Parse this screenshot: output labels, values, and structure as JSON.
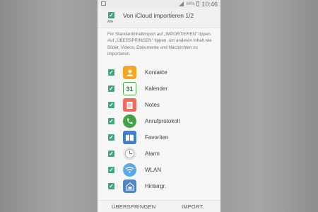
{
  "status_bar": {
    "battery": "64%",
    "time": "10:46"
  },
  "header": {
    "title": "Von iCloud importieren 1/2",
    "all_label": "Alle",
    "all_checked": true
  },
  "description": "Für Standardinhaltimport auf „IMPORTIEREN\" tippen. Auf „ÜBERSPRINGEN\" tippen, um anderen Inhalt wie Bilder, Videos, Dokumente und Nachrichten zu importieren.",
  "items": [
    {
      "label": "Kontakte",
      "icon": "contacts-icon",
      "color": "#f5a623",
      "checked": true
    },
    {
      "label": "Kalender",
      "icon": "calendar-icon",
      "color": "#4caf50",
      "checked": true,
      "icon_text": "31"
    },
    {
      "label": "Notes",
      "icon": "notes-icon",
      "color": "#ef6b5e",
      "checked": true
    },
    {
      "label": "Anrufprotokoll",
      "icon": "call-log-icon",
      "color": "#43a047",
      "checked": true
    },
    {
      "label": "Favoriten",
      "icon": "favorites-icon",
      "color": "#3f7fcf",
      "checked": true
    },
    {
      "label": "Alarm",
      "icon": "alarm-icon",
      "color": "#e8e8e8",
      "checked": true
    },
    {
      "label": "WLAN",
      "icon": "wifi-icon",
      "color": "#5aa9e6",
      "checked": true
    },
    {
      "label": "Hintergr.",
      "icon": "wallpaper-icon",
      "color": "#4f86c6",
      "checked": true
    }
  ],
  "footer": {
    "skip_label": "ÜBERSPRINGEN",
    "import_label": "IMPORT."
  },
  "colors": {
    "checkbox": "#3fa87b",
    "screen_bg": "#f7f7f7"
  }
}
